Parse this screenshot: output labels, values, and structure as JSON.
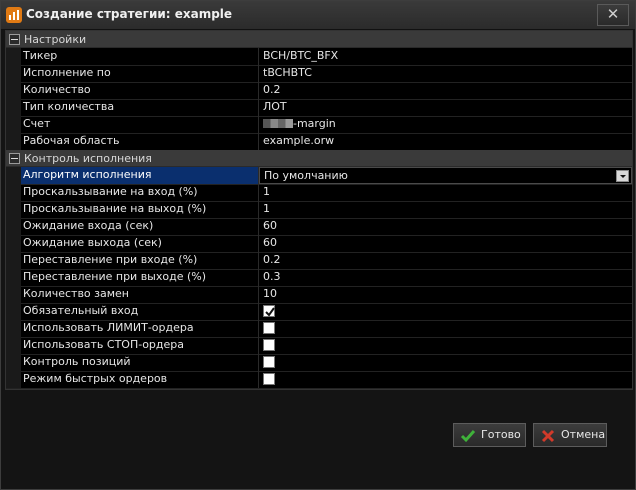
{
  "window": {
    "title": "Создание стратегии: example",
    "close_glyph": "✕"
  },
  "categories": {
    "settings": "Настройки",
    "execution_control": "Контроль исполнения"
  },
  "settings_rows": [
    {
      "name": "Тикер",
      "value": "BCH/BTC_BFX"
    },
    {
      "name": "Исполнение по",
      "value": "tBCHBTC"
    },
    {
      "name": "Количество",
      "value": "0.2"
    },
    {
      "name": "Тип количества",
      "value": "ЛОТ"
    },
    {
      "name": "Счет",
      "value": "-margin"
    },
    {
      "name": "Рабочая область",
      "value": "example.orw"
    }
  ],
  "execution_rows": [
    {
      "name": "Алгоритм исполнения",
      "value": "По умолчанию"
    },
    {
      "name": "Проскальзывание на вход (%)",
      "value": "1"
    },
    {
      "name": "Проскальзывание на выход (%)",
      "value": "1"
    },
    {
      "name": "Ожидание входа (сек)",
      "value": "60"
    },
    {
      "name": "Ожидание выхода (сек)",
      "value": "60"
    },
    {
      "name": "Переставление при входе (%)",
      "value": "0.2"
    },
    {
      "name": "Переставление при выходе (%)",
      "value": "0.3"
    },
    {
      "name": "Количество замен",
      "value": "10"
    }
  ],
  "checkbox_rows": [
    {
      "name": "Обязательный вход",
      "checked": true
    },
    {
      "name": "Использовать ЛИМИТ-ордера",
      "checked": false
    },
    {
      "name": "Использовать СТОП-ордера",
      "checked": false
    },
    {
      "name": "Контроль позиций",
      "checked": false
    },
    {
      "name": "Режим быстрых ордеров",
      "checked": false
    }
  ],
  "buttons": {
    "ok": "Готово",
    "cancel": "Отмена"
  },
  "colors": {
    "selection": "#0a2f6e",
    "ok_icon": "#3fb23a",
    "cancel_icon": "#d23a2a",
    "app_icon": "#e07a14"
  }
}
